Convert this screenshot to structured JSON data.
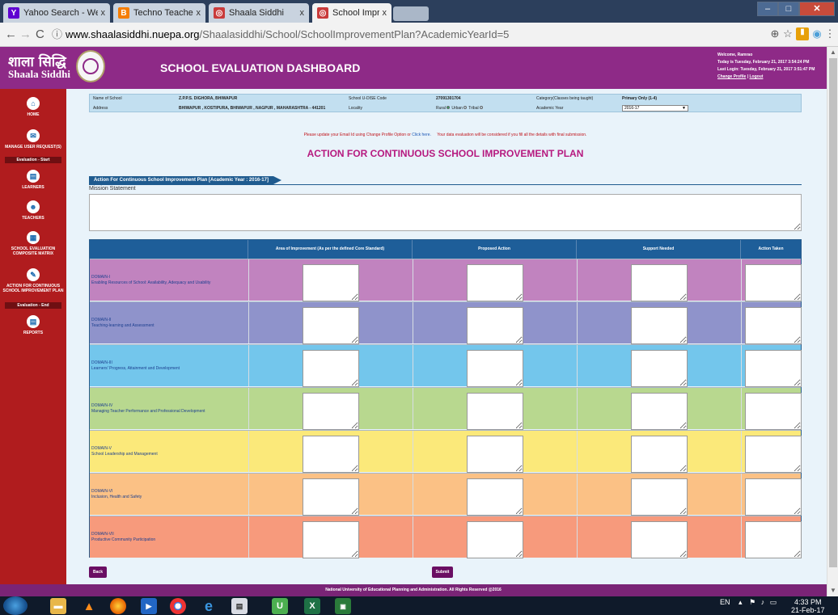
{
  "browser": {
    "tabs": [
      {
        "label": "Yahoo Search - Web Sea",
        "icon": "yahoo-icon",
        "color": "#5f01d1"
      },
      {
        "label": "Techno Teacher",
        "icon": "blogger-icon",
        "color": "#f57d00"
      },
      {
        "label": "Shaala Siddhi",
        "icon": "site-icon",
        "color": "#c93b3b"
      },
      {
        "label": "School Improvement Pla",
        "icon": "site-icon",
        "color": "#c93b3b"
      }
    ],
    "close_glyph": "x",
    "url_host": "www.shaalasiddhi.nuepa.org",
    "url_path": "/Shaalasiddhi/School/SchoolImprovementPlan?AcademicYearId=5"
  },
  "header": {
    "logo_hindi": "शाला सिद्धि",
    "logo_english": "Shaala Siddhi",
    "title": "SCHOOL EVALUATION DASHBOARD",
    "welcome": "Welcome, Ramrao",
    "today": "Today is Tuesday, February 21, 2017 3:54:24 PM",
    "last_login": "Last Login: Tuesday, February 21, 2017 3:51:47 PM",
    "change_profile": "Change Profile",
    "separator": "|",
    "logout": "Logout"
  },
  "sidebar": {
    "items": [
      {
        "label": "HOME",
        "icon": "home-icon",
        "glyph": "⌂"
      },
      {
        "label": "MANAGE USER REQUEST(S)",
        "icon": "user-request-icon",
        "glyph": "✉"
      },
      {
        "label": "LEARNERS",
        "icon": "learners-icon",
        "glyph": "▤"
      },
      {
        "label": "TEACHERS",
        "icon": "teachers-icon",
        "glyph": "☻"
      },
      {
        "label": "SCHOOL EVALUATION COMPOSITE MATRIX",
        "icon": "matrix-icon",
        "glyph": "▦"
      },
      {
        "label": "ACTION FOR CONTINUOUS SCHOOL IMPROVEMENT PLAN",
        "icon": "improvement-plan-icon",
        "glyph": "✎"
      },
      {
        "label": "REPORTS",
        "icon": "reports-icon",
        "glyph": "▤"
      }
    ],
    "eval_start": "Evaluation - Start",
    "eval_end": "Evaluation - End"
  },
  "school_info": {
    "name_label": "Name of School",
    "name_value": "Z.P.P.S. DIGHORA, BHIWAPUR",
    "udise_label": "School U-DISE Code",
    "udise_value": "27091301704",
    "category_label": "Category(Classes being taught)",
    "category_value": "Primary Only (1-4)",
    "address_label": "Address",
    "address_value": "BHIWAPUR , KOSTIPURA, BHIWAPUR , NAGPUR , MAHARASHTRA - 441201",
    "locality_label": "Locality",
    "locality_options": [
      "Rural",
      "Urban",
      "Tribal"
    ],
    "academic_year_label": "Academic Year",
    "academic_year_value": "2016-17"
  },
  "notice": {
    "part1": "Please update your Email Id using Change Profile Option or",
    "link": "Click here.",
    "part2": "Your data evaluation will be considered if you fill all the details with final submission."
  },
  "plan": {
    "title": "ACTION FOR CONTINUOUS SCHOOL IMPROVEMENT PLAN",
    "section_tab": "Action For Continuous School Improvement Plan [Academic Year : 2016-17]",
    "mission_label": "Mission Statement",
    "mission_value": "",
    "columns": [
      "",
      "Area of Improvement (As per the defined Core Standard)",
      "Proposed Action",
      "Support Needed",
      "Action Taken"
    ],
    "rows": [
      {
        "domain": "DOMAIN-I",
        "desc": "Enabling Resources of School: Availability, Adequacy and Usability",
        "color": "#c183bf"
      },
      {
        "domain": "DOMAIN-II",
        "desc": "Teaching-learning and Assessment",
        "color": "#8f93cb"
      },
      {
        "domain": "DOMAIN-III",
        "desc": "Learners' Progress, Attainment and Development",
        "color": "#73c6ec"
      },
      {
        "domain": "DOMAIN-IV",
        "desc": "Managing Teacher Performance and Professional Development",
        "color": "#b8d88f"
      },
      {
        "domain": "DOMAIN-V",
        "desc": "School Leadership and Management",
        "color": "#fbe97a"
      },
      {
        "domain": "DOMAIN-VI",
        "desc": "Inclusion, Health and Safety",
        "color": "#fbc185"
      },
      {
        "domain": "DOMAIN-VII",
        "desc": "Productive Community Participation",
        "color": "#f79a7c"
      }
    ],
    "back_label": "Back",
    "submit_label": "Submit"
  },
  "footer": "National University of Educational Planning and Administration. All Rights Reserved @2016",
  "taskbar": {
    "language": "EN",
    "time": "4:33 PM",
    "date": "21-Feb-17"
  }
}
